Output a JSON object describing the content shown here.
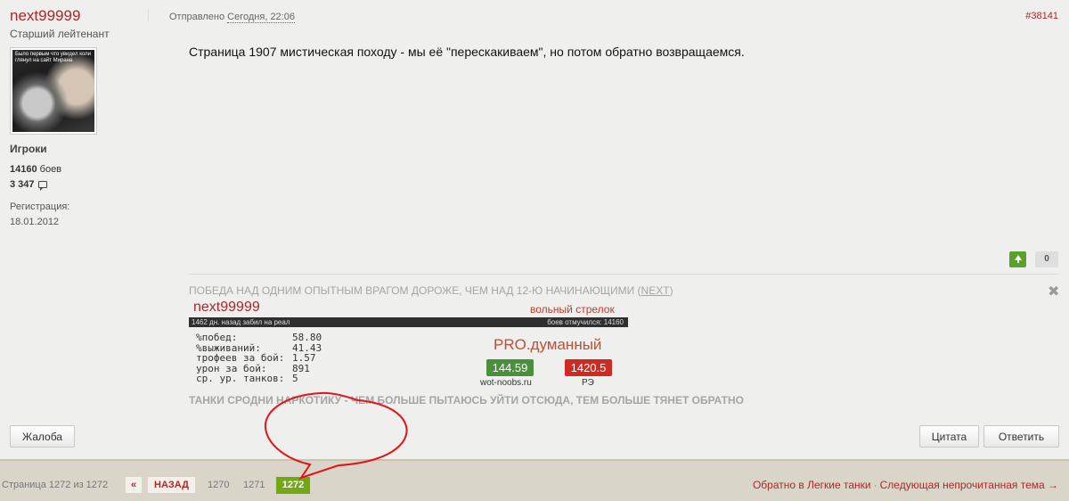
{
  "author": {
    "username": "next99999",
    "rank": "Старший лейтенант",
    "avatar_text": "Было первым что увидел коли глянул на сайт Мирана",
    "group": "Игроки",
    "battles_count": "14160",
    "battles_label": " боев",
    "posts_count": "3 347",
    "reg_label": "Регистрация:",
    "reg_date": "18.01.2012"
  },
  "post": {
    "sent_prefix": "Отправлено ",
    "sent_time": "Сегодня, 22:06",
    "id": "#38141",
    "text": "Страница 1907 мистическая походу - мы её \"перескакиваем\", но потом обратно возвращаемся.",
    "rating": "0"
  },
  "signature": {
    "line1": "ПОБЕДА НАД ОДНИМ ОПЫТНЫМ ВРАГОМ ДОРОЖЕ, ЧЕМ НАД 12-Ю НАЧИНАЮЩИМИ (",
    "line1_link": "NEXT",
    "line1_end": ")",
    "line2": "ТАНКИ СРОДНИ НАРКОТИКУ - ЧЕМ БОЛЬШЕ ПЫТАЮСЬ УЙТИ ОТСЮДА, ТЕМ БОЛЬШЕ ТЯНЕТ ОБРАТНО",
    "banner": {
      "name": "next99999",
      "class": "вольный стрелок",
      "bar_left": "1462 дн. назад забил на реал",
      "bar_right": "боев отмучился: 14160",
      "stats": [
        {
          "k": "%побед:",
          "v": "58.80"
        },
        {
          "k": "%выживаний:",
          "v": "41.43"
        },
        {
          "k": "трофеев за бой:",
          "v": "1.57"
        },
        {
          "k": "урон за бой:",
          "v": "891"
        },
        {
          "k": "ср. ур. танков:",
          "v": "5"
        }
      ],
      "pro_label": "PRO.думанный",
      "badge1": "144.59",
      "badge2": "1420.5",
      "src1": "wot-noobs.ru",
      "src2": "РЭ"
    }
  },
  "buttons": {
    "complain": "Жалоба",
    "quote": "Цитата",
    "reply": "Ответить"
  },
  "pager": {
    "label": "Страница 1272 из 1272",
    "prev_arrow": "«",
    "back": "НАЗАД",
    "page1": "1270",
    "page2": "1271",
    "current": "1272",
    "back_to": "Обратно в Легкие танки",
    "separator": "·",
    "next_topic": "Следующая непрочитанная тема →"
  },
  "colors": {
    "accent_red": "#a8292b",
    "current_page_green": "#73a715",
    "annotation": "#e3141a"
  }
}
